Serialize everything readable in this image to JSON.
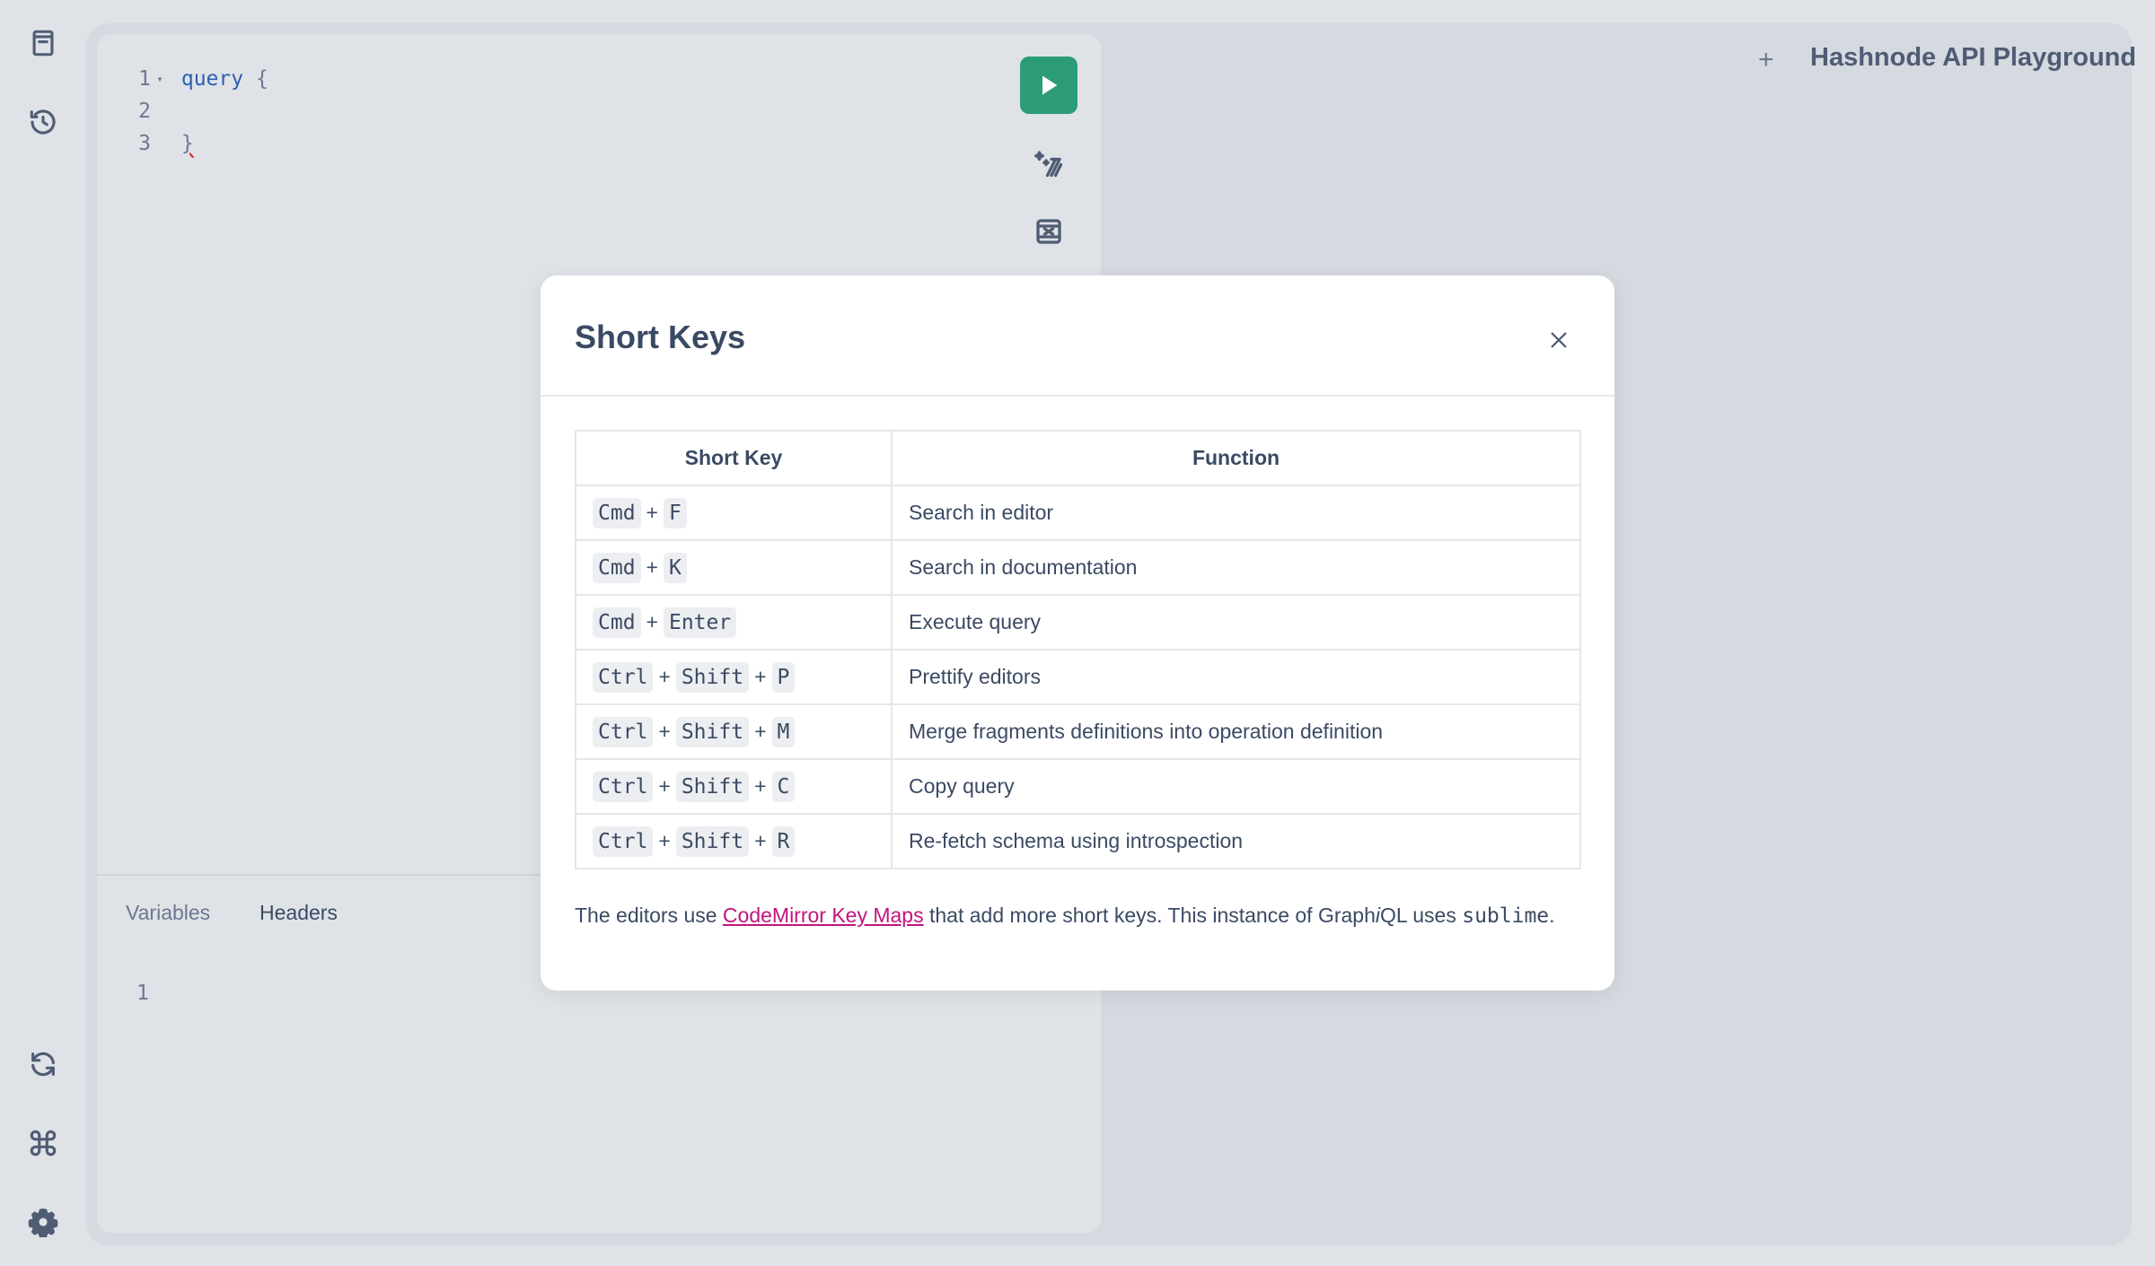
{
  "rail": {
    "top_icons": [
      "docs-icon",
      "history-icon"
    ],
    "bottom_icons": [
      "refresh-icon",
      "shortcuts-icon",
      "settings-icon"
    ]
  },
  "editor": {
    "lines": [
      {
        "num": "1",
        "fold": "▾",
        "tokens": [
          {
            "t": "query",
            "c": "kw"
          },
          {
            "t": " {",
            "c": "pn"
          }
        ]
      },
      {
        "num": "2",
        "fold": "",
        "tokens": []
      },
      {
        "num": "3",
        "fold": "",
        "tokens": [
          {
            "t": "}",
            "c": "err"
          }
        ]
      }
    ]
  },
  "toolbar": {
    "run_icon": "play-icon",
    "prettify_icon": "prettify-icon",
    "merge_icon": "merge-icon"
  },
  "bottom_tabs": {
    "variables": "Variables",
    "headers": "Headers",
    "line_number": "1"
  },
  "header": {
    "new_tab": "+",
    "title": "Hashnode API Playground"
  },
  "modal": {
    "title": "Short Keys",
    "columns": [
      "Short Key",
      "Function"
    ],
    "rows": [
      {
        "keys": [
          "Cmd",
          "F"
        ],
        "function": "Search in editor"
      },
      {
        "keys": [
          "Cmd",
          "K"
        ],
        "function": "Search in documentation"
      },
      {
        "keys": [
          "Cmd",
          "Enter"
        ],
        "function": "Execute query"
      },
      {
        "keys": [
          "Ctrl",
          "Shift",
          "P"
        ],
        "function": "Prettify editors"
      },
      {
        "keys": [
          "Ctrl",
          "Shift",
          "M"
        ],
        "function": "Merge fragments definitions into operation definition"
      },
      {
        "keys": [
          "Ctrl",
          "Shift",
          "C"
        ],
        "function": "Copy query"
      },
      {
        "keys": [
          "Ctrl",
          "Shift",
          "R"
        ],
        "function": "Re-fetch schema using introspection"
      }
    ],
    "footnote": {
      "prefix": "The editors use ",
      "link": "CodeMirror Key Maps",
      "middle": " that add more short keys. This instance of Graph",
      "italic": "i",
      "after_italic": "QL uses ",
      "code": "sublime",
      "suffix": "."
    }
  },
  "colors": {
    "accent_run": "#2b9c77",
    "link": "#c2157c",
    "text": "#3b4a63"
  }
}
